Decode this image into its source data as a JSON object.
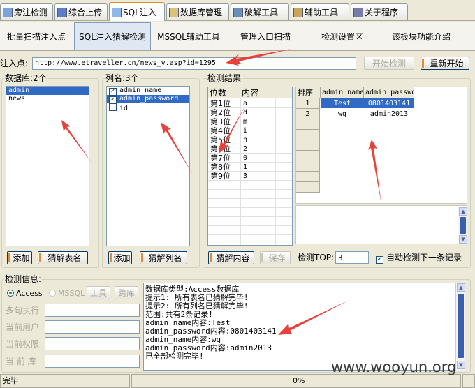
{
  "top_tabs": [
    {
      "label": "旁注检测",
      "icon": "sidenote-icon"
    },
    {
      "label": "综合上传",
      "icon": "upload-icon"
    },
    {
      "label": "SQL注入",
      "icon": "sql-icon"
    },
    {
      "label": "数据库管理",
      "icon": "database-icon"
    },
    {
      "label": "破解工具",
      "icon": "crack-icon"
    },
    {
      "label": "辅助工具",
      "icon": "tools-icon"
    },
    {
      "label": "关于程序",
      "icon": "about-icon"
    }
  ],
  "sub_tabs": [
    "批量扫描注入点",
    "SQL注入猜解检测",
    "MSSQL辅助工具",
    "管理入口扫描",
    "检测设置区",
    "该板块功能介绍"
  ],
  "inject": {
    "label": "注入点:",
    "url": "http://www.etraveller.cn/news_v.asp?id=1295",
    "start_button": "开始检测",
    "restart_button": "重新开始"
  },
  "db_panel": {
    "title": "数据库:2个",
    "items": [
      "admin",
      "news"
    ],
    "add_button": "添加",
    "guess_button": "猜解表名"
  },
  "col_panel": {
    "title": "列名:3个",
    "items": [
      {
        "name": "admin_name",
        "checked": true
      },
      {
        "name": "admin_password",
        "checked": true
      },
      {
        "name": "id",
        "checked": false
      }
    ],
    "add_button": "添加",
    "guess_button": "猜解列名"
  },
  "result_panel": {
    "title": "检测结果",
    "pos_headers": [
      "位数",
      "内容"
    ],
    "pos_rows": [
      [
        "第1位",
        "a"
      ],
      [
        "第2位",
        "d"
      ],
      [
        "第3位",
        "m"
      ],
      [
        "第4位",
        "i"
      ],
      [
        "第5位",
        "n"
      ],
      [
        "第6位",
        "2"
      ],
      [
        "第7位",
        "0"
      ],
      [
        "第8位",
        "1"
      ],
      [
        "第9位",
        "3"
      ]
    ],
    "rec_headers": [
      "排序",
      "admin_name",
      "admin_password"
    ],
    "rec_rows": [
      [
        "1",
        "Test",
        "0801403141"
      ],
      [
        "2",
        "wg",
        "admin2013"
      ]
    ],
    "guess_button": "猜解内容",
    "save_button": "保存",
    "top_label": "检测TOP:",
    "top_value": "3",
    "auto_label": "自动检测下一条记录"
  },
  "info_panel": {
    "title": "检测信息:",
    "radio_access": "Access",
    "radio_mssql": "MSSQL",
    "tool_button": "工具",
    "cross_button": "跨库",
    "labels": [
      "多句执行",
      "当前用户",
      "当前权限",
      "当 前 库"
    ],
    "log": [
      "数据库类型:Access数据库",
      "提示1: 所有表名已猜解完毕!",
      "提示2: 所有列名已猜解完毕!",
      "范围:共有2条记录!",
      "admin_name内容:Test",
      "admin_password内容:0801403141",
      "admin_name内容:wg",
      "admin_password内容:admin2013",
      "已全部检测完毕!"
    ]
  },
  "status": {
    "text": "完毕",
    "progress": "0%"
  },
  "watermark": "www.wooyun.org",
  "colors": {
    "accent": "#e68b2c",
    "selection": "#316ac5",
    "arrow": "#e8413c"
  }
}
